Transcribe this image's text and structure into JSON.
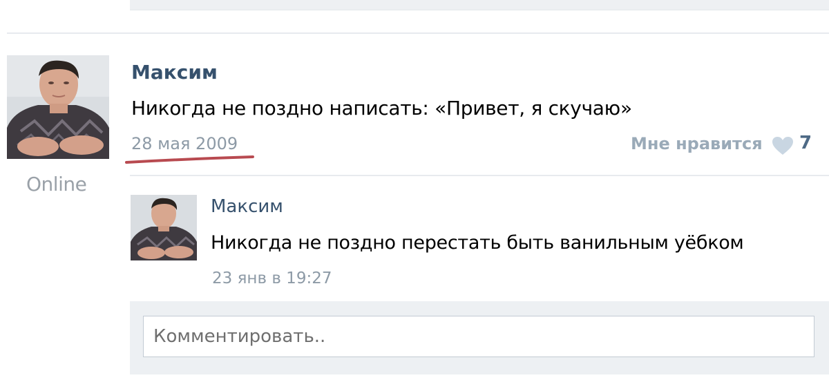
{
  "post": {
    "author": "Максим",
    "text": "Никогда не поздно написать: «Привет, я скучаю»",
    "date": "28 мая 2009",
    "status": "Online",
    "like_label": "Мне нравится",
    "like_count": "7"
  },
  "reply": {
    "author": "Максим",
    "text": "Никогда не поздно перестать быть ванильным уёбком",
    "date": "23 янв в 19:27"
  },
  "comment": {
    "placeholder": "Комментировать.."
  },
  "colors": {
    "link": "#36516d",
    "date": "#8d9aa6",
    "annotation_underline": "#b84a50"
  },
  "icons": {
    "like": "heart-icon"
  }
}
